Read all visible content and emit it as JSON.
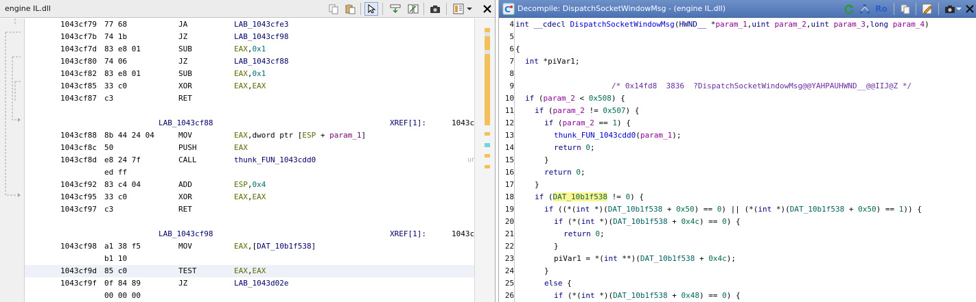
{
  "listing_window": {
    "title": "engine IL.dll",
    "toolbar_icons": [
      "copy-icon",
      "paste-icon",
      "cursor-select-icon",
      "navigation-icon",
      "diff-icon",
      "snapshot-icon",
      "field-layout-icon",
      "dropdown-arrow-icon",
      "close-icon"
    ]
  },
  "listing_rows": [
    {
      "type": "instr",
      "addr": "1043cf79",
      "bytes": "77 68",
      "mnem": "JA",
      "operand": [
        {
          "t": "LAB_1043cfe3",
          "c": "lab"
        }
      ]
    },
    {
      "type": "instr",
      "addr": "1043cf7b",
      "bytes": "74 1b",
      "mnem": "JZ",
      "operand": [
        {
          "t": "LAB_1043cf98",
          "c": "lab"
        }
      ]
    },
    {
      "type": "instr",
      "addr": "1043cf7d",
      "bytes": "83 e8 01",
      "mnem": "SUB",
      "operand": [
        {
          "t": "EAX",
          "c": "reg"
        },
        {
          "t": ",",
          "c": "plain"
        },
        {
          "t": "0x1",
          "c": "hex"
        }
      ]
    },
    {
      "type": "instr",
      "addr": "1043cf80",
      "bytes": "74 06",
      "mnem": "JZ",
      "operand": [
        {
          "t": "LAB_1043cf88",
          "c": "lab"
        }
      ]
    },
    {
      "type": "instr",
      "addr": "1043cf82",
      "bytes": "83 e8 01",
      "mnem": "SUB",
      "operand": [
        {
          "t": "EAX",
          "c": "reg"
        },
        {
          "t": ",",
          "c": "plain"
        },
        {
          "t": "0x1",
          "c": "hex"
        }
      ]
    },
    {
      "type": "instr",
      "addr": "1043cf85",
      "bytes": "33 c0",
      "mnem": "XOR",
      "operand": [
        {
          "t": "EAX",
          "c": "reg"
        },
        {
          "t": ",",
          "c": "plain"
        },
        {
          "t": "EAX",
          "c": "reg"
        }
      ]
    },
    {
      "type": "instr",
      "addr": "1043cf87",
      "bytes": "c3",
      "mnem": "RET",
      "operand": []
    },
    {
      "type": "blank"
    },
    {
      "type": "label",
      "label": "LAB_1043cf88",
      "xref": "XREF[1]:",
      "xaddr": "1043c"
    },
    {
      "type": "instr",
      "addr": "1043cf88",
      "bytes": "8b 44 24 04",
      "mnem": "MOV",
      "operand": [
        {
          "t": "EAX",
          "c": "reg"
        },
        {
          "t": ",dword ptr [",
          "c": "plain"
        },
        {
          "t": "ESP",
          "c": "reg"
        },
        {
          "t": " + ",
          "c": "plain"
        },
        {
          "t": "param_1",
          "c": "param"
        },
        {
          "t": "]",
          "c": "plain"
        }
      ]
    },
    {
      "type": "instr",
      "addr": "1043cf8c",
      "bytes": "50",
      "mnem": "PUSH",
      "operand": [
        {
          "t": "EAX",
          "c": "reg"
        }
      ]
    },
    {
      "type": "instr",
      "addr": "1043cf8d",
      "bytes": "e8 24 7f",
      "mnem": "CALL",
      "operand": [
        {
          "t": "thunk_FUN_1043cdd0",
          "c": "lab"
        }
      ],
      "comment": "un"
    },
    {
      "type": "cont",
      "bytes": "ed ff"
    },
    {
      "type": "instr",
      "addr": "1043cf92",
      "bytes": "83 c4 04",
      "mnem": "ADD",
      "operand": [
        {
          "t": "ESP",
          "c": "reg"
        },
        {
          "t": ",",
          "c": "plain"
        },
        {
          "t": "0x4",
          "c": "hex"
        }
      ]
    },
    {
      "type": "instr",
      "addr": "1043cf95",
      "bytes": "33 c0",
      "mnem": "XOR",
      "operand": [
        {
          "t": "EAX",
          "c": "reg"
        },
        {
          "t": ",",
          "c": "plain"
        },
        {
          "t": "EAX",
          "c": "reg"
        }
      ]
    },
    {
      "type": "instr",
      "addr": "1043cf97",
      "bytes": "c3",
      "mnem": "RET",
      "operand": []
    },
    {
      "type": "blank"
    },
    {
      "type": "label",
      "label": "LAB_1043cf98",
      "xref": "XREF[1]:",
      "xaddr": "1043c"
    },
    {
      "type": "instr",
      "addr": "1043cf98",
      "bytes": "a1 38 f5",
      "mnem": "MOV",
      "operand": [
        {
          "t": "EAX",
          "c": "reg"
        },
        {
          "t": ",[",
          "c": "plain"
        },
        {
          "t": "DAT_10b1f538",
          "c": "dat"
        },
        {
          "t": "]",
          "c": "plain"
        }
      ]
    },
    {
      "type": "cont",
      "bytes": "b1 10"
    },
    {
      "type": "instr",
      "addr": "1043cf9d",
      "bytes": "85 c0",
      "mnem": "TEST",
      "operand": [
        {
          "t": "EAX",
          "c": "reg"
        },
        {
          "t": ",",
          "c": "plain"
        },
        {
          "t": "EAX",
          "c": "reg"
        }
      ],
      "cursor": true
    },
    {
      "type": "instr",
      "addr": "1043cf9f",
      "bytes": "0f 84 89",
      "mnem": "JZ",
      "operand": [
        {
          "t": "LAB_1043d02e",
          "c": "lab"
        }
      ]
    },
    {
      "type": "cont",
      "bytes": "00 00 00"
    }
  ],
  "decompile_window": {
    "title": "Decompile: DispatchSocketWindowMsg - (engine IL.dll)",
    "toolbar_icons": [
      "refresh-icon",
      "graph-icon",
      "read-only-icon",
      "copy-icon",
      "edit-icon",
      "snapshot-icon",
      "dropdown-arrow-icon",
      "close-icon"
    ],
    "ro_label": "Ro"
  },
  "code_lines": [
    {
      "n": "4",
      "text": "int __cdecl DispatchSocketWindowMsg(HWND__ *param_1,uint param_2,uint param_3,long param_4)",
      "indent": 0
    },
    {
      "n": "5",
      "text": "",
      "indent": 0
    },
    {
      "n": "6",
      "text": "{",
      "indent": 0
    },
    {
      "n": "7",
      "text": "int *piVar1;",
      "indent": 1
    },
    {
      "n": "8",
      "text": "",
      "indent": 0
    },
    {
      "n": "9",
      "text": "/* 0x14fd8  3836  ?DispatchSocketWindowMsg@@YAHPAUHWND__@@IIJ@Z */",
      "indent": 10
    },
    {
      "n": "10",
      "text": "if (param_2 < 0x508) {",
      "indent": 1
    },
    {
      "n": "11",
      "text": "if (param_2 != 0x507) {",
      "indent": 2
    },
    {
      "n": "12",
      "text": "if (param_2 == 1) {",
      "indent": 3
    },
    {
      "n": "13",
      "text": "thunk_FUN_1043cdd0(param_1);",
      "indent": 4
    },
    {
      "n": "14",
      "text": "return 0;",
      "indent": 4
    },
    {
      "n": "15",
      "text": "}",
      "indent": 3
    },
    {
      "n": "16",
      "text": "return 0;",
      "indent": 3
    },
    {
      "n": "17",
      "text": "}",
      "indent": 2
    },
    {
      "n": "18",
      "text": "if (DAT_10b1f538 != 0) {",
      "indent": 2,
      "highlight": "DAT_10b1f538"
    },
    {
      "n": "19",
      "text": "if ((*(int *)(DAT_10b1f538 + 0x50) == 0) || (*(int *)(DAT_10b1f538 + 0x50) == 1)) {",
      "indent": 3
    },
    {
      "n": "20",
      "text": "if (*(int *)(DAT_10b1f538 + 0x4c) == 0) {",
      "indent": 4
    },
    {
      "n": "21",
      "text": "return 0;",
      "indent": 5
    },
    {
      "n": "22",
      "text": "}",
      "indent": 4
    },
    {
      "n": "23",
      "text": "piVar1 = *(int **)(DAT_10b1f538 + 0x4c);",
      "indent": 4
    },
    {
      "n": "24",
      "text": "}",
      "indent": 3
    },
    {
      "n": "25",
      "text": "else {",
      "indent": 3
    },
    {
      "n": "26",
      "text": "if (*(int *)(DAT_10b1f538 + 0x48) == 0) {",
      "indent": 4
    }
  ],
  "colors": {
    "keyword": "#00007f",
    "type": "#00007f",
    "function": "#0000d0",
    "variable": "#000000",
    "global": "#006060",
    "param": "#8a0093",
    "number": "#006a4e",
    "comment": "#6a2d9e",
    "highlight": "#fff58a",
    "title_bar": "#4c73b4"
  }
}
